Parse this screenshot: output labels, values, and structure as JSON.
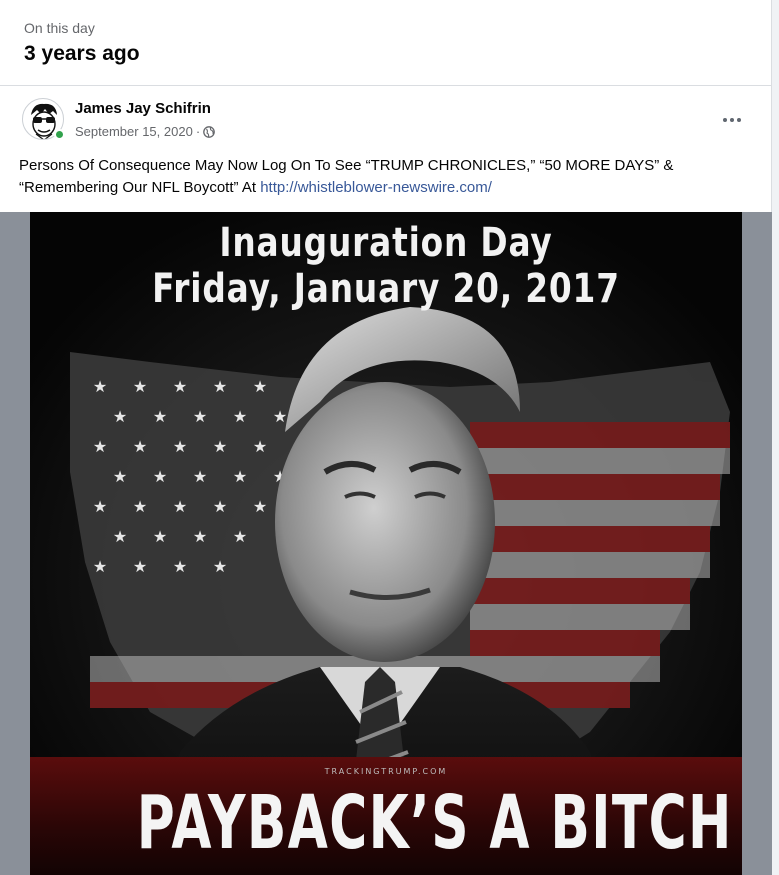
{
  "memories": {
    "label": "On this day",
    "title": "3 years ago"
  },
  "post": {
    "author": "James Jay Schifrin",
    "date": "September 15, 2020",
    "date_separator": "·",
    "privacy_icon": "globe-icon",
    "more_icon": "more-options-icon",
    "text_line1": "Persons Of Consequence May Now Log On To See “TRUMP CHRONICLES,” “50 MORE DAYS” &",
    "text_line2": "“Remembering Our NFL Boycott” At ",
    "link": "http://whistleblower-newswire.com/"
  },
  "image": {
    "heading_line1": "Inauguration Day",
    "heading_line2": "Friday, January 20, 2017",
    "credit": "TRACKINGTRUMP.COM",
    "caption": "PAYBACK’S A BITCH"
  },
  "colors": {
    "accent_link": "#385898",
    "online": "#31a24c",
    "secondary_text": "#65676b"
  }
}
